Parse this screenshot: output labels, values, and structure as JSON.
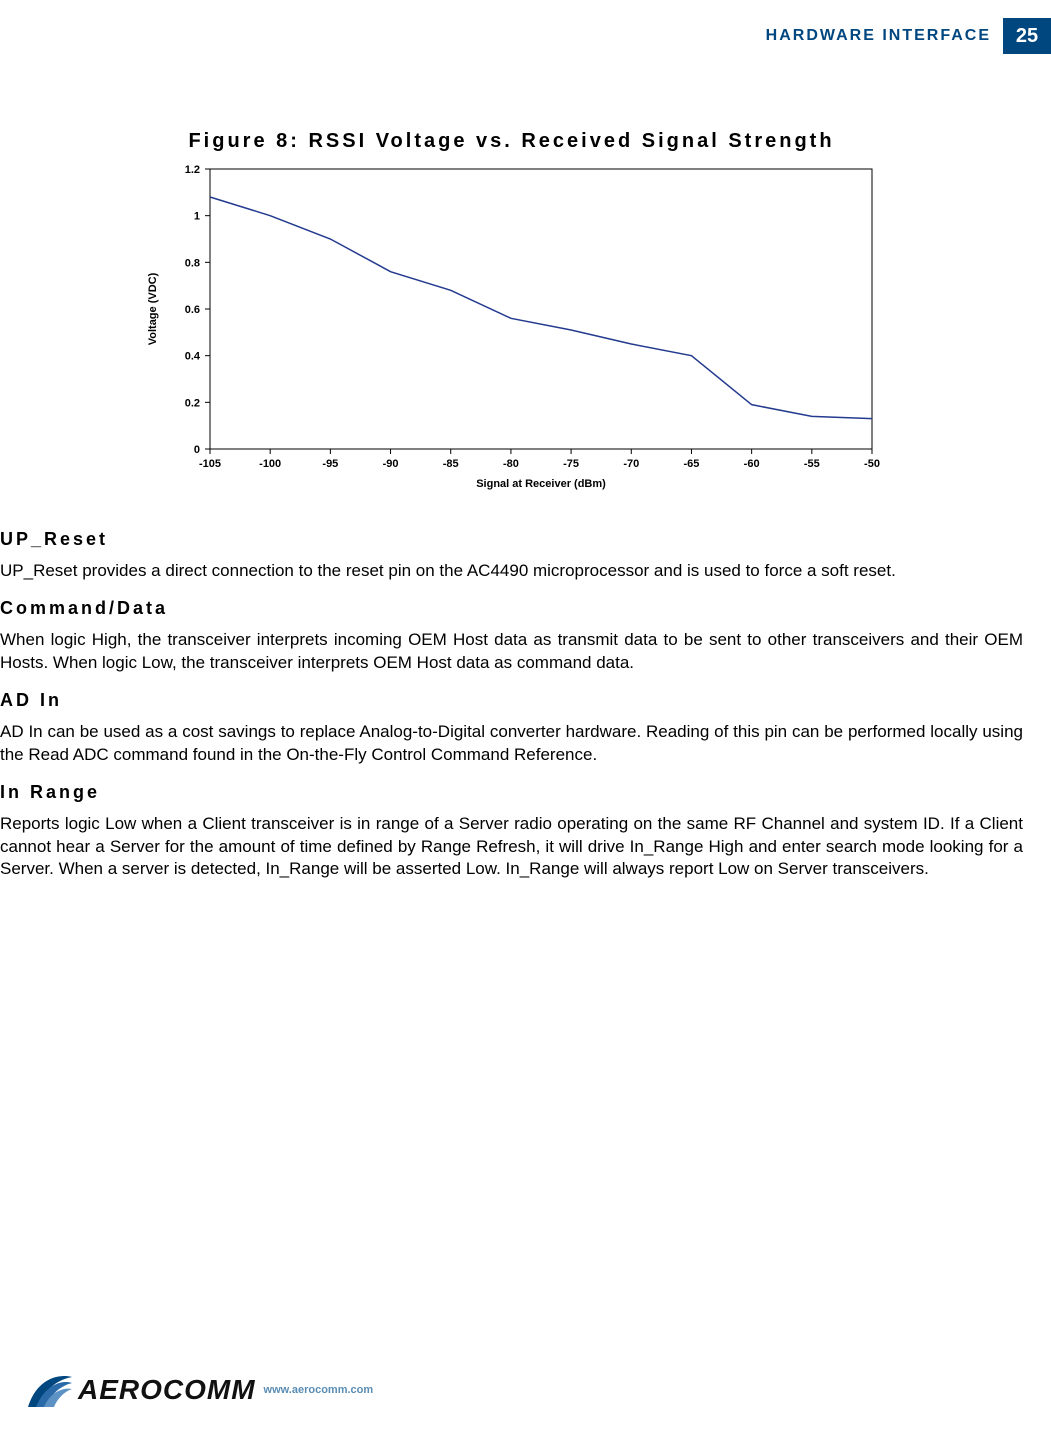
{
  "header": {
    "title": "HARDWARE INTERFACE",
    "page_number": "25"
  },
  "figure": {
    "caption": "Figure 8: RSSI Voltage vs. Received Signal Strength",
    "ylabel": "Voltage (VDC)",
    "xlabel": "Signal at Receiver (dBm)"
  },
  "chart_data": {
    "type": "line",
    "title": "Figure 8: RSSI Voltage vs. Received Signal Strength",
    "xlabel": "Signal at Receiver (dBm)",
    "ylabel": "Voltage (VDC)",
    "xlim": [
      -105,
      -50
    ],
    "ylim": [
      0,
      1.2
    ],
    "x_ticks": [
      -105,
      -100,
      -95,
      -90,
      -85,
      -80,
      -75,
      -70,
      -65,
      -60,
      -55,
      -50
    ],
    "y_ticks": [
      0,
      0.2,
      0.4,
      0.6,
      0.8,
      1,
      1.2
    ],
    "x": [
      -105,
      -100,
      -95,
      -90,
      -85,
      -80,
      -75,
      -70,
      -65,
      -60,
      -55,
      -50
    ],
    "y": [
      1.08,
      1.0,
      0.9,
      0.76,
      0.68,
      0.56,
      0.51,
      0.45,
      0.4,
      0.19,
      0.14,
      0.13
    ],
    "line_color": "#233a8f"
  },
  "sections": [
    {
      "heading": "UP_Reset",
      "body": "UP_Reset provides a direct connection to the reset pin on the AC4490 microprocessor and is used to force a soft reset."
    },
    {
      "heading": "Command/Data",
      "body": "When logic High, the transceiver interprets incoming OEM Host data as transmit data to be sent to other transceivers and their OEM Hosts. When logic Low, the transceiver interprets OEM Host data as command data."
    },
    {
      "heading": "AD In",
      "body": "AD In can be used as a cost savings to replace Analog-to-Digital converter hardware.  Reading of this pin can be performed locally using the Read ADC command found in the On-the-Fly Control Command Reference."
    },
    {
      "heading": "In Range",
      "body": "Reports logic Low when a Client transceiver is in range of a Server radio operating on the same RF Channel and system ID.  If a Client cannot hear a Server for the amount of time defined by Range Refresh, it will drive In_Range High and enter search mode looking for a Server.  When a server is detected, In_Range will be asserted Low.  In_Range will always report Low on Server transceivers."
    }
  ],
  "footer": {
    "brand": "AEROCOMM",
    "url": "www.aerocomm.com"
  }
}
